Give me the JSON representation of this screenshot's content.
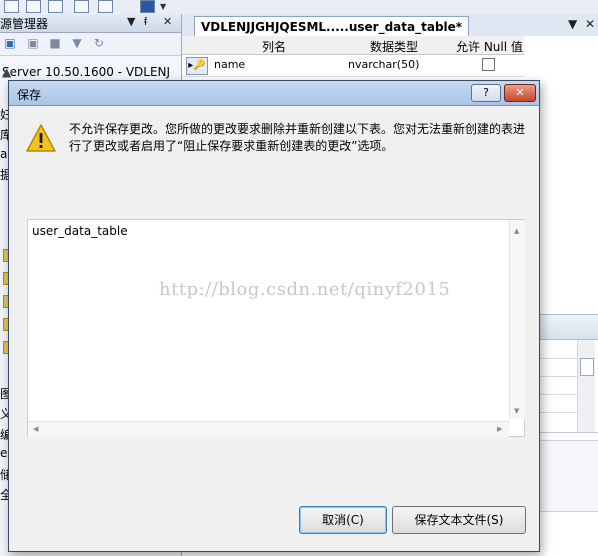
{
  "ide": {
    "left_panel": {
      "title": "源管理器",
      "header_controls": [
        "▼",
        "ᵮ",
        "✕"
      ],
      "server_node": "Server 10.50.1600 - VDLENJ",
      "fragments": [
        "妇",
        "库",
        "ao",
        "据",
        "图",
        "义",
        "编",
        "er",
        "储",
        "全"
      ]
    },
    "doc_tab": {
      "label": "VDLENJJGHJQESML.....user_data_table*"
    },
    "grid": {
      "columns": [
        "列名",
        "数据类型",
        "允许 Null 值"
      ],
      "rows": [
        {
          "name": "name",
          "type": "nvarchar(50)",
          "allow_null": false
        }
      ]
    }
  },
  "dialog": {
    "title": "保存",
    "help_label": "?",
    "close_label": "✕",
    "message": "不允许保存更改。您所做的更改要求删除并重新创建以下表。您对无法重新创建的表进行了更改或者启用了“阻止保存要求重新创建表的更改”选项。",
    "table_list_value": "user_data_table",
    "watermark": "http://blog.csdn.net/qinyf2015",
    "buttons": {
      "cancel": "取消(C)",
      "save_text": "保存文本文件(S)"
    }
  },
  "colors": {
    "titlebar": "#a9c5ea",
    "close_button": "#c8452c",
    "warning": "#f3c21b"
  }
}
